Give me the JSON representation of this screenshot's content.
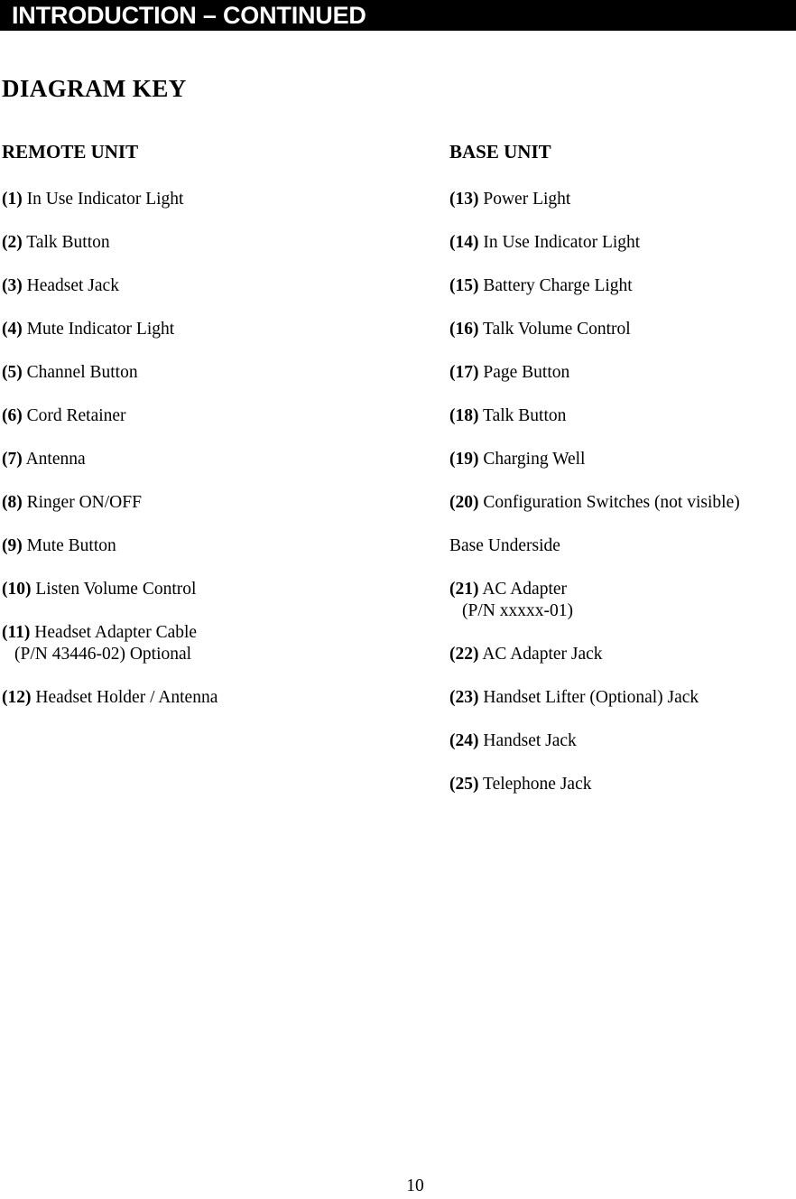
{
  "banner": {
    "title": "INTRODUCTION – CONTINUED"
  },
  "page_heading": "DIAGRAM KEY",
  "columns": {
    "left": {
      "title": "REMOTE UNIT",
      "entries": [
        {
          "num": "(1)",
          "label": "In Use Indicator Light"
        },
        {
          "num": "(2)",
          "label": "Talk Button"
        },
        {
          "num": "(3)",
          "label": "Headset Jack"
        },
        {
          "num": "(4)",
          "label": "Mute Indicator Light"
        },
        {
          "num": "(5)",
          "label": "Channel Button"
        },
        {
          "num": "(6)",
          "label": "Cord Retainer"
        },
        {
          "num": "(7)",
          "label": "Antenna"
        },
        {
          "num": "(8)",
          "label": "Ringer ON/OFF"
        },
        {
          "num": "(9)",
          "label": "Mute Button"
        },
        {
          "num": "(10)",
          "label": "Listen Volume Control"
        },
        {
          "num": "(11)",
          "label": "Headset Adapter Cable",
          "sub": "(P/N 43446-02) Optional"
        },
        {
          "num": "(12)",
          "label": "Headset Holder / Antenna"
        }
      ]
    },
    "right": {
      "title": "BASE UNIT",
      "entries": [
        {
          "num": "(13)",
          "label": "Power Light"
        },
        {
          "num": "(14)",
          "label": "In Use Indicator Light"
        },
        {
          "num": "(15)",
          "label": "Battery Charge Light"
        },
        {
          "num": "(16)",
          "label": "Talk Volume Control"
        },
        {
          "num": "(17)",
          "label": "Page Button"
        },
        {
          "num": "(18)",
          "label": "Talk Button"
        },
        {
          "num": "(19)",
          "label": "Charging Well"
        },
        {
          "num": "(20)",
          "label": "Configuration Switches (not visible)"
        }
      ],
      "subsection": {
        "heading": "Base Underside",
        "entries": [
          {
            "num": "(21)",
            "label": "AC Adapter",
            "sub": "(P/N xxxxx-01)"
          },
          {
            "num": "(22)",
            "label": "AC Adapter Jack"
          },
          {
            "num": "(23)",
            "label": "Handset Lifter (Optional) Jack"
          },
          {
            "num": "(24)",
            "label": "Handset Jack"
          },
          {
            "num": "(25)",
            "label": "Telephone Jack"
          }
        ]
      }
    }
  },
  "folio": "10"
}
